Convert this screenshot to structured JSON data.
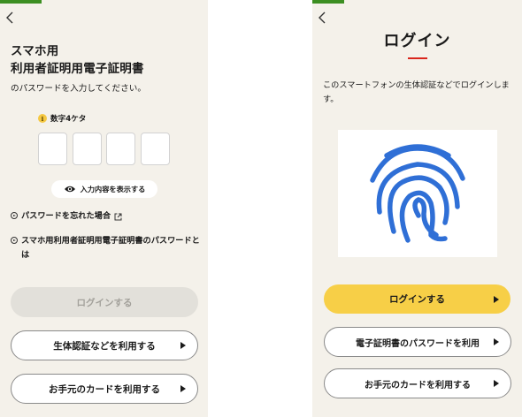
{
  "left_screen": {
    "progress_percent": 20,
    "back_icon": "chevron-left-icon",
    "title_line1": "スマホ用",
    "title_line2": "利用者証明用電子証明書",
    "subtitle": "のパスワードを入力してください。",
    "hint_icon": "info-icon",
    "hint_text": "数字4ケタ",
    "pin_digits": [
      "",
      "",
      "",
      ""
    ],
    "show_input_label": "入力内容を表示する",
    "forgot_password_link": "パスワードを忘れた場合",
    "about_password_link": "スマホ用利用者証明用電子証明書のパスワードとは",
    "login_button": "ログインする",
    "biometric_button": "生体認証などを利用する",
    "card_button": "お手元のカードを利用する"
  },
  "right_screen": {
    "progress_percent": 15,
    "back_icon": "chevron-left-icon",
    "title": "ログイン",
    "description": "このスマートフォンの生体認証などでログインします。",
    "image_icon": "fingerprint-icon",
    "login_button": "ログインする",
    "cert_password_button": "電子証明書のパスワードを利用",
    "card_button": "お手元のカードを利用する"
  },
  "colors": {
    "progress": "#3c8f22",
    "primary_button": "#f7cf47",
    "fingerprint": "#2f6fd6",
    "accent_line": "#d9261c",
    "background": "#f4f1ea"
  }
}
